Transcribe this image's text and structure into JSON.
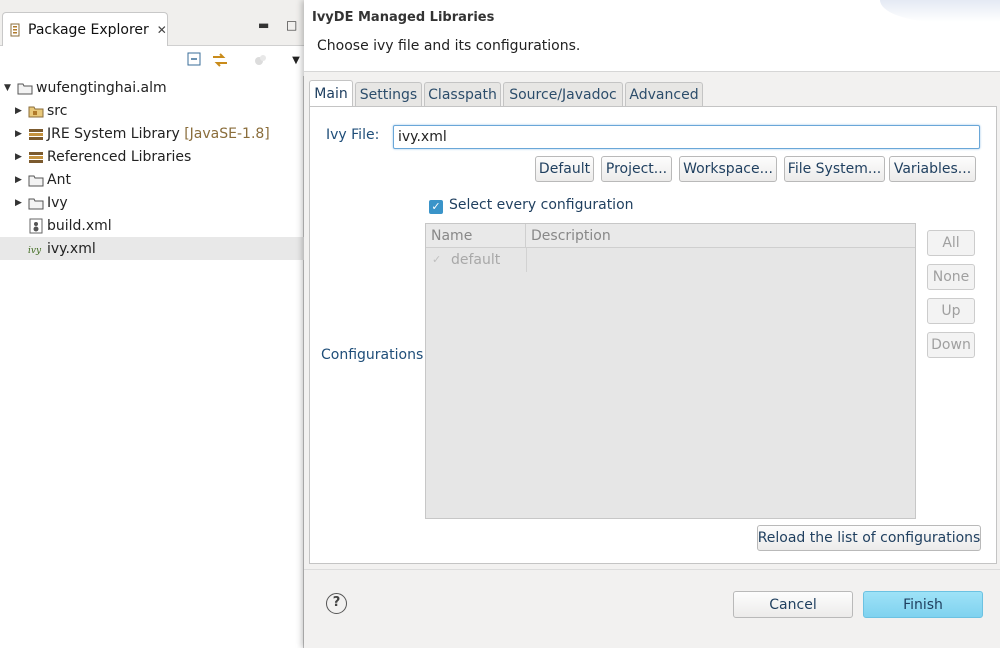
{
  "explorer": {
    "title": "Package Explorer",
    "close_glyph": "✕",
    "minimize_glyph": "▬",
    "maximize_glyph": "□",
    "tree": [
      {
        "label": "wufengtinghai.alm",
        "decoration": "",
        "icon": "project-folder-icon",
        "arrow": "▼",
        "level": 0
      },
      {
        "label": "src",
        "decoration": "",
        "icon": "package-folder-icon",
        "arrow": "▶",
        "level": 1
      },
      {
        "label": "JRE System Library",
        "decoration": "[JavaSE-1.8]",
        "icon": "library-icon",
        "arrow": "▶",
        "level": 1
      },
      {
        "label": "Referenced Libraries",
        "decoration": "",
        "icon": "library-icon",
        "arrow": "▶",
        "level": 1
      },
      {
        "label": "Ant",
        "decoration": "",
        "icon": "folder-icon",
        "arrow": "▶",
        "level": 1
      },
      {
        "label": "Ivy",
        "decoration": "",
        "icon": "folder-icon",
        "arrow": "▶",
        "level": 1
      },
      {
        "label": "build.xml",
        "decoration": "",
        "icon": "ant-file-icon",
        "arrow": "",
        "level": 1
      },
      {
        "label": "ivy.xml",
        "decoration": "",
        "icon": "ivy-file-icon",
        "arrow": "",
        "level": 1
      }
    ]
  },
  "dialog": {
    "title": "IvyDE Managed Libraries",
    "description": "Choose ivy file and its configurations.",
    "tabs": [
      "Main",
      "Settings",
      "Classpath",
      "Source/Javadoc",
      "Advanced"
    ],
    "ivy_file_label": "Ivy File:",
    "ivy_file_value": "ivy.xml",
    "file_buttons": [
      "Default",
      "Project...",
      "Workspace...",
      "File System...",
      "Variables..."
    ],
    "select_every_label": "Select every configuration",
    "configurations_label": "Configurations",
    "table": {
      "headers": [
        "Name",
        "Description"
      ],
      "rows": [
        {
          "name": "default",
          "description": ""
        }
      ]
    },
    "side_buttons": [
      "All",
      "None",
      "Up",
      "Down"
    ],
    "reload_label": "Reload the list of configurations",
    "help_glyph": "?",
    "cancel_label": "Cancel",
    "finish_label": "Finish"
  }
}
